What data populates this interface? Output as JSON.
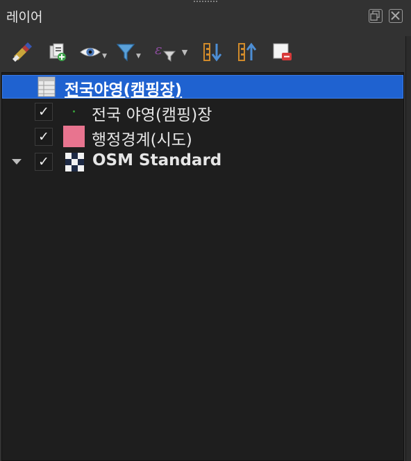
{
  "window": {
    "title": "레이어",
    "float_button": "float-panel",
    "close_button": "close-panel"
  },
  "toolbar": {
    "buttons": [
      {
        "name": "style-manager",
        "icon": "paintbrush-icon"
      },
      {
        "name": "add-group",
        "icon": "add-group-icon"
      },
      {
        "name": "manage-visibility",
        "icon": "eye-icon"
      },
      {
        "name": "filter-legend",
        "icon": "filter-icon"
      },
      {
        "name": "filter-by-expression",
        "icon": "expression-filter-icon"
      },
      {
        "name": "expand-all",
        "icon": "expand-all-icon"
      },
      {
        "name": "collapse-all",
        "icon": "collapse-all-icon"
      },
      {
        "name": "remove-layer",
        "icon": "remove-layer-icon"
      }
    ]
  },
  "layers": [
    {
      "label": "전국야영(캠핑장)",
      "selected": true,
      "checked": null,
      "symbol": "table-icon"
    },
    {
      "label": "전국 야영(캠핑)장",
      "selected": false,
      "checked": true,
      "symbol": "point-symbol",
      "color": "#38a13a"
    },
    {
      "label": "행정경계(시도)",
      "selected": false,
      "checked": true,
      "symbol": "polygon-symbol",
      "color": "#e8748f"
    },
    {
      "label": "OSM Standard",
      "selected": false,
      "checked": true,
      "symbol": "raster-icon",
      "expandable": true
    }
  ],
  "check_glyph": "✓"
}
